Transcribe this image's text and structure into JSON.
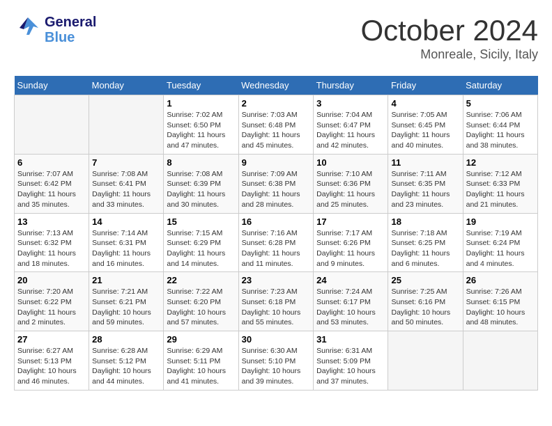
{
  "header": {
    "logo_general": "General",
    "logo_blue": "Blue",
    "month_title": "October 2024",
    "location": "Monreale, Sicily, Italy"
  },
  "weekdays": [
    "Sunday",
    "Monday",
    "Tuesday",
    "Wednesday",
    "Thursday",
    "Friday",
    "Saturday"
  ],
  "weeks": [
    [
      {
        "day": "",
        "info": ""
      },
      {
        "day": "",
        "info": ""
      },
      {
        "day": "1",
        "info": "Sunrise: 7:02 AM\nSunset: 6:50 PM\nDaylight: 11 hours and 47 minutes."
      },
      {
        "day": "2",
        "info": "Sunrise: 7:03 AM\nSunset: 6:48 PM\nDaylight: 11 hours and 45 minutes."
      },
      {
        "day": "3",
        "info": "Sunrise: 7:04 AM\nSunset: 6:47 PM\nDaylight: 11 hours and 42 minutes."
      },
      {
        "day": "4",
        "info": "Sunrise: 7:05 AM\nSunset: 6:45 PM\nDaylight: 11 hours and 40 minutes."
      },
      {
        "day": "5",
        "info": "Sunrise: 7:06 AM\nSunset: 6:44 PM\nDaylight: 11 hours and 38 minutes."
      }
    ],
    [
      {
        "day": "6",
        "info": "Sunrise: 7:07 AM\nSunset: 6:42 PM\nDaylight: 11 hours and 35 minutes."
      },
      {
        "day": "7",
        "info": "Sunrise: 7:08 AM\nSunset: 6:41 PM\nDaylight: 11 hours and 33 minutes."
      },
      {
        "day": "8",
        "info": "Sunrise: 7:08 AM\nSunset: 6:39 PM\nDaylight: 11 hours and 30 minutes."
      },
      {
        "day": "9",
        "info": "Sunrise: 7:09 AM\nSunset: 6:38 PM\nDaylight: 11 hours and 28 minutes."
      },
      {
        "day": "10",
        "info": "Sunrise: 7:10 AM\nSunset: 6:36 PM\nDaylight: 11 hours and 25 minutes."
      },
      {
        "day": "11",
        "info": "Sunrise: 7:11 AM\nSunset: 6:35 PM\nDaylight: 11 hours and 23 minutes."
      },
      {
        "day": "12",
        "info": "Sunrise: 7:12 AM\nSunset: 6:33 PM\nDaylight: 11 hours and 21 minutes."
      }
    ],
    [
      {
        "day": "13",
        "info": "Sunrise: 7:13 AM\nSunset: 6:32 PM\nDaylight: 11 hours and 18 minutes."
      },
      {
        "day": "14",
        "info": "Sunrise: 7:14 AM\nSunset: 6:31 PM\nDaylight: 11 hours and 16 minutes."
      },
      {
        "day": "15",
        "info": "Sunrise: 7:15 AM\nSunset: 6:29 PM\nDaylight: 11 hours and 14 minutes."
      },
      {
        "day": "16",
        "info": "Sunrise: 7:16 AM\nSunset: 6:28 PM\nDaylight: 11 hours and 11 minutes."
      },
      {
        "day": "17",
        "info": "Sunrise: 7:17 AM\nSunset: 6:26 PM\nDaylight: 11 hours and 9 minutes."
      },
      {
        "day": "18",
        "info": "Sunrise: 7:18 AM\nSunset: 6:25 PM\nDaylight: 11 hours and 6 minutes."
      },
      {
        "day": "19",
        "info": "Sunrise: 7:19 AM\nSunset: 6:24 PM\nDaylight: 11 hours and 4 minutes."
      }
    ],
    [
      {
        "day": "20",
        "info": "Sunrise: 7:20 AM\nSunset: 6:22 PM\nDaylight: 11 hours and 2 minutes."
      },
      {
        "day": "21",
        "info": "Sunrise: 7:21 AM\nSunset: 6:21 PM\nDaylight: 10 hours and 59 minutes."
      },
      {
        "day": "22",
        "info": "Sunrise: 7:22 AM\nSunset: 6:20 PM\nDaylight: 10 hours and 57 minutes."
      },
      {
        "day": "23",
        "info": "Sunrise: 7:23 AM\nSunset: 6:18 PM\nDaylight: 10 hours and 55 minutes."
      },
      {
        "day": "24",
        "info": "Sunrise: 7:24 AM\nSunset: 6:17 PM\nDaylight: 10 hours and 53 minutes."
      },
      {
        "day": "25",
        "info": "Sunrise: 7:25 AM\nSunset: 6:16 PM\nDaylight: 10 hours and 50 minutes."
      },
      {
        "day": "26",
        "info": "Sunrise: 7:26 AM\nSunset: 6:15 PM\nDaylight: 10 hours and 48 minutes."
      }
    ],
    [
      {
        "day": "27",
        "info": "Sunrise: 6:27 AM\nSunset: 5:13 PM\nDaylight: 10 hours and 46 minutes."
      },
      {
        "day": "28",
        "info": "Sunrise: 6:28 AM\nSunset: 5:12 PM\nDaylight: 10 hours and 44 minutes."
      },
      {
        "day": "29",
        "info": "Sunrise: 6:29 AM\nSunset: 5:11 PM\nDaylight: 10 hours and 41 minutes."
      },
      {
        "day": "30",
        "info": "Sunrise: 6:30 AM\nSunset: 5:10 PM\nDaylight: 10 hours and 39 minutes."
      },
      {
        "day": "31",
        "info": "Sunrise: 6:31 AM\nSunset: 5:09 PM\nDaylight: 10 hours and 37 minutes."
      },
      {
        "day": "",
        "info": ""
      },
      {
        "day": "",
        "info": ""
      }
    ]
  ]
}
